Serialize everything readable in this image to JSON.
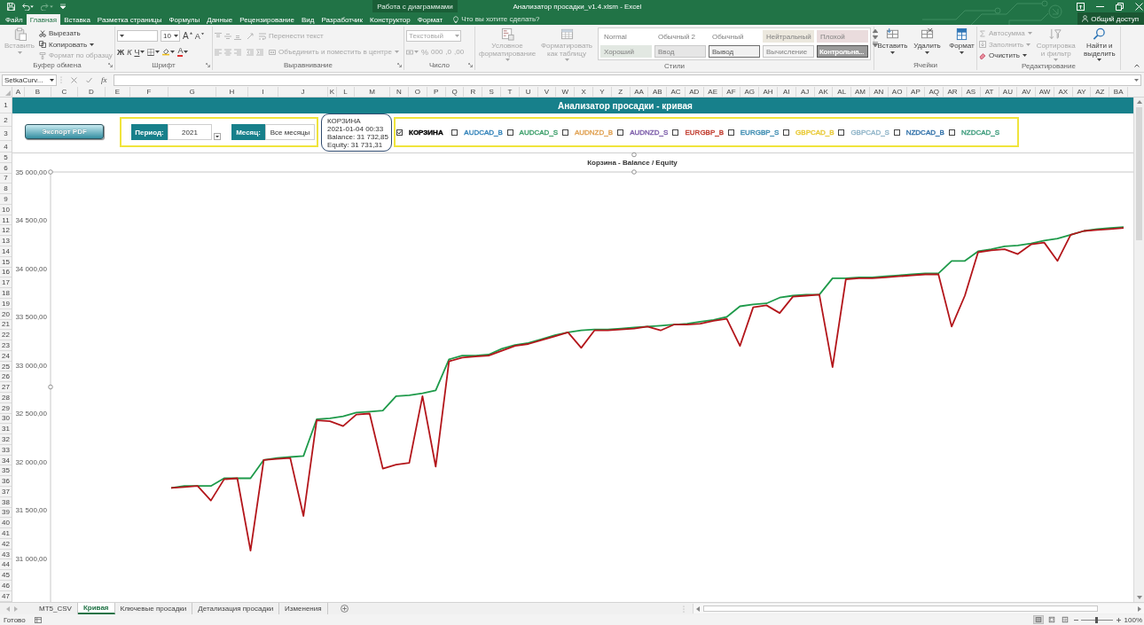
{
  "title_bar": {
    "quick_access": [
      {
        "kind": "save",
        "disabled": false
      },
      {
        "kind": "undo",
        "disabled": false
      },
      {
        "kind": "redo",
        "disabled": true
      },
      {
        "kind": "customize",
        "disabled": false
      }
    ],
    "context_group": "Работа с диаграммами",
    "title": "Анализатор просадки_v1.4.xlsm - Excel"
  },
  "tabs": [
    {
      "label": "Файл",
      "selected": false
    },
    {
      "label": "Главная",
      "selected": true
    },
    {
      "label": "Вставка",
      "selected": false
    },
    {
      "label": "Разметка страницы",
      "selected": false
    },
    {
      "label": "Формулы",
      "selected": false
    },
    {
      "label": "Данные",
      "selected": false
    },
    {
      "label": "Рецензирование",
      "selected": false
    },
    {
      "label": "Вид",
      "selected": false
    },
    {
      "label": "Разработчик",
      "selected": false
    },
    {
      "label": "Конструктор",
      "selected": false
    },
    {
      "label": "Формат",
      "selected": false
    }
  ],
  "tell_me": {
    "placeholder": "Что вы хотите сделать?"
  },
  "share": {
    "label": "Общий доступ"
  },
  "ribbon": {
    "groups": [
      {
        "kind": "clipboard",
        "label": "Буфер обмена",
        "paste": {
          "label": "Вставить",
          "disabled": true
        },
        "items": [
          {
            "label": "Вырезать",
            "disabled": false
          },
          {
            "label": "Копировать",
            "disabled": false
          },
          {
            "label": "Формат по образцу",
            "disabled": true
          }
        ]
      },
      {
        "kind": "font",
        "label": "Шрифт",
        "disabled": false,
        "size": "10",
        "grow": "A",
        "shrink": "A",
        "bold": "Ж",
        "italic": "К",
        "underline": "Ч",
        "font_color": "A"
      },
      {
        "kind": "alignment",
        "label": "Выравнивание",
        "disabled": true,
        "wrap": "Перенести текст",
        "merge": "Объединить и поместить в центре"
      },
      {
        "kind": "number",
        "label": "Число",
        "disabled": true,
        "format": "Текстовый",
        "percent": "%",
        "thousands": "000",
        "decimals": [
          ",0",
          ",00"
        ]
      },
      {
        "kind": "styles",
        "label": "Стили",
        "disabled": true,
        "commands": [
          "Условное форматирование",
          "Форматировать как таблицу"
        ],
        "gallery": [
          {
            "label": "Normal",
            "kind": "normal"
          },
          {
            "label": "Обычный 2",
            "kind": "normal"
          },
          {
            "label": "Обычный",
            "kind": "normal"
          },
          {
            "label": "Нейтральный",
            "kind": "neutral"
          },
          {
            "label": "Плохой",
            "kind": "bad"
          },
          {
            "label": "Хороший",
            "kind": "good"
          },
          {
            "label": "Ввод",
            "kind": "input"
          },
          {
            "label": "Вывод",
            "kind": "output"
          },
          {
            "label": "Вычисление",
            "kind": "calculation"
          },
          {
            "label": "Контрольна...",
            "kind": "check"
          }
        ]
      },
      {
        "kind": "cells",
        "label": "Ячейки",
        "disabled": false,
        "commands": [
          "Вставить",
          "Удалить",
          "Формат"
        ]
      },
      {
        "kind": "editing",
        "label": "Редактирование",
        "items": [
          {
            "label": "Автосумма",
            "disabled": true
          },
          {
            "label": "Заполнить",
            "disabled": true
          },
          {
            "label": "Очистить",
            "disabled": false
          }
        ],
        "big": [
          {
            "label": "Сортировка и фильтр",
            "disabled": true
          },
          {
            "label": "Найти и выделить",
            "disabled": false
          }
        ]
      }
    ]
  },
  "formula_bar": {
    "name_box": "SetkaCurv...",
    "fx": "fx"
  },
  "sheet": {
    "columns": [
      "A",
      "B",
      "C",
      "D",
      "E",
      "F",
      "G",
      "H",
      "I",
      "J",
      "K",
      "L",
      "M",
      "N",
      "O",
      "P",
      "Q",
      "R",
      "S",
      "T",
      "U",
      "V",
      "W",
      "X",
      "Y",
      "Z",
      "AA",
      "AB",
      "AC",
      "AD",
      "AE",
      "AF",
      "AG",
      "AH",
      "AI",
      "AJ",
      "AK",
      "AL",
      "AM",
      "AN",
      "AO",
      "AP",
      "AQ",
      "AR",
      "AS",
      "AT",
      "AU",
      "AV",
      "AW",
      "AX",
      "AY",
      "AZ",
      "BA"
    ],
    "rows": [
      "1",
      "2",
      "3",
      "4",
      "5",
      "6",
      "7",
      "8",
      "9",
      "10",
      "11",
      "12",
      "13",
      "14",
      "15",
      "16",
      "17",
      "18",
      "19",
      "20",
      "21",
      "22",
      "23",
      "24",
      "25",
      "26",
      "27",
      "28",
      "29",
      "30",
      "31",
      "32",
      "33",
      "34",
      "35",
      "36",
      "37",
      "38",
      "39",
      "40",
      "41",
      "42",
      "43",
      "44",
      "45",
      "46",
      "47"
    ]
  },
  "banner": {
    "title": "Анализатор просадки - кривая"
  },
  "export_button": {
    "label": "Экспорт PDF"
  },
  "period": {
    "label": "Период:",
    "value": "2021"
  },
  "month": {
    "label": "Месяц:",
    "value": "Все месяцы"
  },
  "callout": {
    "lines": [
      "КОРЗИНА",
      "2021-01-04 00:33",
      "Balance: 31 732,85",
      "Equity: 31 731,31"
    ]
  },
  "filters": [
    {
      "label": "КОРЗИНА",
      "checked": true,
      "color": "#000000"
    },
    {
      "label": "AUDCAD_B",
      "checked": false,
      "color": "#2f80b8"
    },
    {
      "label": "AUDCAD_S",
      "checked": false,
      "color": "#3a9e68"
    },
    {
      "label": "AUDNZD_B",
      "checked": false,
      "color": "#e0a050"
    },
    {
      "label": "AUDNZD_S",
      "checked": false,
      "color": "#7a5aa8"
    },
    {
      "label": "EURGBP_B",
      "checked": false,
      "color": "#c0392b"
    },
    {
      "label": "EURGBP_S",
      "checked": false,
      "color": "#3a8ab0"
    },
    {
      "label": "GBPCAD_B",
      "checked": false,
      "color": "#e8c830"
    },
    {
      "label": "GBPCAD_S",
      "checked": false,
      "color": "#8fb4c8"
    },
    {
      "label": "NZDCAD_B",
      "checked": false,
      "color": "#2e6fa8"
    },
    {
      "label": "NZDCAD_S",
      "checked": false,
      "color": "#3a9a7a"
    }
  ],
  "chart": {
    "chart_data": {
      "type": "line",
      "title": "Корзина - Balance / Equity",
      "tick_labels": "y",
      "ylim": [
        30550,
        35000
      ],
      "yticks": [
        {
          "value": 31000,
          "label": "31 000,00"
        },
        {
          "value": 31500,
          "label": "31 500,00"
        },
        {
          "value": 32000,
          "label": "32 000,00"
        },
        {
          "value": 32500,
          "label": "32 500,00"
        },
        {
          "value": 33000,
          "label": "33 000,00"
        },
        {
          "value": 33500,
          "label": "33 500,00"
        },
        {
          "value": 34000,
          "label": "34 000,00"
        },
        {
          "value": 34500,
          "label": "34 500,00"
        },
        {
          "value": 35000,
          "label": "35 000,00"
        }
      ],
      "categories": [
        null,
        null,
        null,
        null,
        null,
        null,
        null,
        null,
        null,
        null,
        null,
        null,
        null,
        null,
        null,
        null,
        null,
        null,
        null,
        null,
        null,
        null,
        null,
        null,
        null,
        null,
        null,
        null,
        null,
        null,
        null,
        null,
        null,
        null,
        null,
        null,
        null,
        null,
        null,
        null,
        null,
        null,
        null,
        null,
        null,
        null,
        null,
        null,
        null,
        null,
        null,
        null,
        null,
        null,
        null,
        null,
        null,
        null,
        null,
        null,
        null,
        null,
        null,
        null,
        null,
        null,
        null,
        null,
        null,
        null,
        null,
        null,
        null
      ],
      "series": [
        {
          "color": "#1e9a4a",
          "values": [
            31730,
            31750,
            31750,
            31750,
            31830,
            31830,
            31830,
            32020,
            32040,
            32050,
            32060,
            32440,
            32450,
            32470,
            32510,
            32520,
            32530,
            32680,
            32690,
            32710,
            32740,
            33060,
            33100,
            33100,
            33110,
            33170,
            33210,
            33230,
            33270,
            33310,
            33340,
            33360,
            33370,
            33370,
            33380,
            33390,
            33400,
            33410,
            33420,
            33430,
            33450,
            33470,
            33500,
            33610,
            33630,
            33640,
            33700,
            33720,
            33730,
            33730,
            33900,
            33900,
            33910,
            33910,
            33920,
            33930,
            33940,
            33950,
            33950,
            34080,
            34080,
            34180,
            34200,
            34230,
            34240,
            34260,
            34290,
            34310,
            34350,
            34390,
            34410,
            34420,
            34430
          ]
        },
        {
          "color": "#b3161b",
          "values": [
            31730,
            31740,
            31750,
            31600,
            31820,
            31830,
            31080,
            32020,
            32030,
            32040,
            31440,
            32430,
            32420,
            32370,
            32490,
            32500,
            31930,
            31970,
            31990,
            32680,
            31950,
            33040,
            33080,
            33090,
            33100,
            33150,
            33200,
            33220,
            33260,
            33300,
            33340,
            33180,
            33360,
            33360,
            33370,
            33380,
            33400,
            33360,
            33420,
            33420,
            33430,
            33460,
            33480,
            33200,
            33600,
            33620,
            33540,
            33710,
            33720,
            33730,
            32980,
            33890,
            33900,
            33900,
            33910,
            33920,
            33930,
            33940,
            33940,
            33400,
            33720,
            34170,
            34190,
            34200,
            34150,
            34250,
            34270,
            34080,
            34350,
            34390,
            34400,
            34410,
            34420
          ]
        }
      ]
    }
  },
  "sheet_tabs": [
    {
      "label": "MT5_CSV",
      "selected": false
    },
    {
      "label": "Кривая",
      "selected": true
    },
    {
      "label": "Ключевые просадки",
      "selected": false
    },
    {
      "label": "Детализация просадки",
      "selected": false
    },
    {
      "label": "Изменения",
      "selected": false
    }
  ],
  "status_bar": {
    "status": "Готово",
    "views": [
      {
        "kind": "normal",
        "selected": true
      },
      {
        "kind": "page_layout",
        "selected": false
      },
      {
        "kind": "page_break",
        "selected": false
      }
    ],
    "zoom": {
      "level": 0.5,
      "reading": "100%"
    }
  }
}
